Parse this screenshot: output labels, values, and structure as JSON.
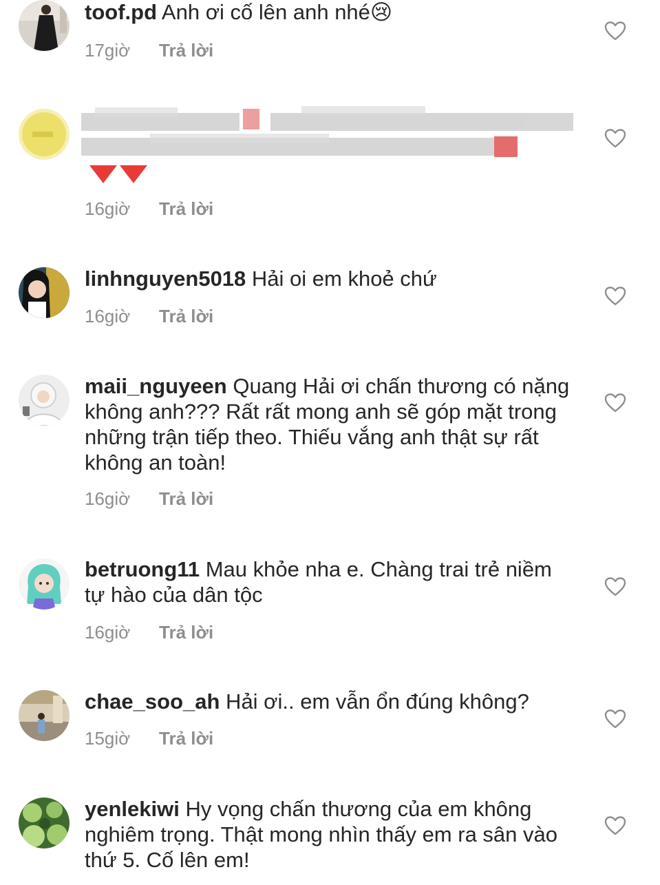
{
  "comments": [
    {
      "username": "toof.pd",
      "text": " Anh ơi cố lên anh nhé😢",
      "time": "17giờ",
      "reply": "Trả lời",
      "avatar_icon": "avatar-girl-black-dress"
    },
    {
      "username": "",
      "text": "",
      "time": "16giờ",
      "reply": "Trả lời",
      "avatar_icon": "avatar-blurred-yellow",
      "blurred": true
    },
    {
      "username": "linhnguyen5018",
      "text": " Hải oi em khoẻ chứ",
      "time": "16giờ",
      "reply": "Trả lời",
      "avatar_icon": "avatar-girl-portrait"
    },
    {
      "username": "maii_nguyeen",
      "text": " Quang Hải ơi chấn thương có nặng không anh??? Rất rất mong anh sẽ góp mặt trong những trận tiếp theo. Thiếu vắng anh thật sự rất không an toàn!",
      "time": "16giờ",
      "reply": "Trả lời",
      "avatar_icon": "avatar-child-white-hat"
    },
    {
      "username": "betruong11",
      "text": " Mau khỏe nha e. Chàng trai trẻ niềm tự hào của dân tộc",
      "time": "16giờ",
      "reply": "Trả lời",
      "avatar_icon": "avatar-cartoon-green-hair"
    },
    {
      "username": "chae_soo_ah",
      "text": " Hải ơi.. em vẫn ổn đúng không?",
      "time": "15giờ",
      "reply": "Trả lời",
      "avatar_icon": "avatar-person-indoors"
    },
    {
      "username": "yenlekiwi",
      "text": " Hy vọng chấn thương của em không nghiêm trọng. Thật mong nhìn thấy em ra sân vào thứ 5. Cố lên em!",
      "time": "",
      "reply": "",
      "avatar_icon": "avatar-green-fruits"
    }
  ],
  "colors": {
    "text": "#262626",
    "meta": "#8e8e8e",
    "heart_outline": "#8e8e8e",
    "heart_emoji": "#e0463b"
  }
}
